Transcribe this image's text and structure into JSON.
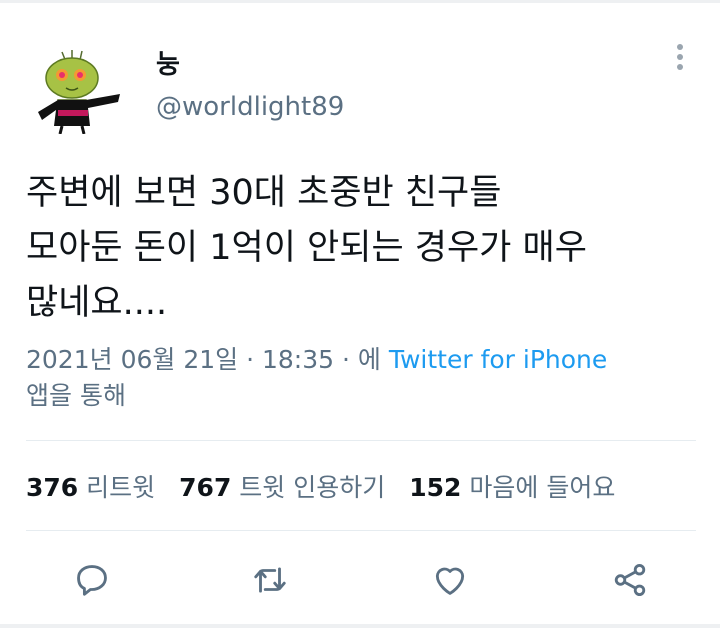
{
  "tweet": {
    "display_name": "눙",
    "handle": "@worldlight89",
    "text": "주변에 보면 30대 초중반 친구들\n모아둔 돈이 1억이 안되는 경우가 매우\n많네요....",
    "meta_prefix": "2021년 06월 21일 · 18:35 · 에 ",
    "meta_source": "Twitter for iPhone",
    "meta_suffix": "앱을 통해"
  },
  "stats": {
    "retweets_count": "376",
    "retweets_label": "리트윗",
    "quotes_count": "767",
    "quotes_label": "트윗 인용하기",
    "likes_count": "152",
    "likes_label": "마음에 들어요"
  },
  "actions": {
    "icons": [
      "reply-icon",
      "retweet-icon",
      "like-icon",
      "share-icon"
    ]
  },
  "colors": {
    "link": "#1d9bf0",
    "secondary": "#5b7083",
    "text": "#0f1419",
    "icon": "#5b7083"
  }
}
